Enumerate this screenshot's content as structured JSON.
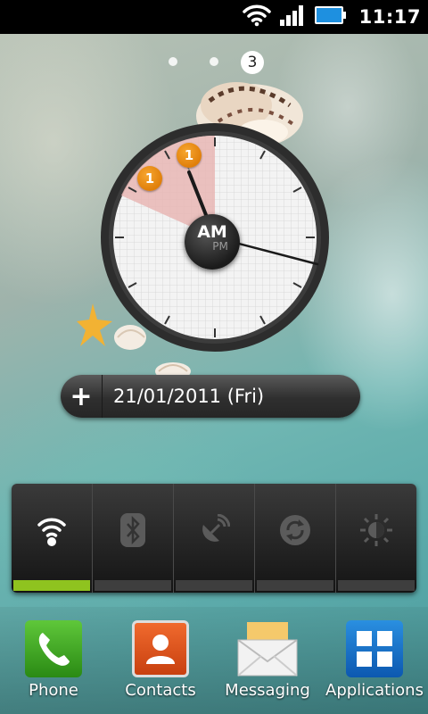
{
  "status_bar": {
    "time": "11:17",
    "icons": [
      "wifi-icon",
      "signal-icon",
      "battery-icon"
    ]
  },
  "home_screen": {
    "current_page": "3",
    "page_count": 3
  },
  "clock_widget": {
    "am_label": "AM",
    "pm_label": "PM",
    "badges": [
      "1",
      "1"
    ]
  },
  "date_widget": {
    "add_label": "+",
    "date": "21/01/2011 (Fri)"
  },
  "power_control": {
    "toggles": [
      {
        "name": "wifi",
        "icon": "wifi-icon",
        "enabled": true
      },
      {
        "name": "bluetooth",
        "icon": "bluetooth-icon",
        "enabled": false
      },
      {
        "name": "gps",
        "icon": "gps-icon",
        "enabled": false
      },
      {
        "name": "sync",
        "icon": "sync-icon",
        "enabled": false
      },
      {
        "name": "brightness",
        "icon": "brightness-icon",
        "enabled": false
      }
    ]
  },
  "dock": {
    "items": [
      {
        "label": "Phone",
        "icon": "phone-icon"
      },
      {
        "label": "Contacts",
        "icon": "contacts-icon"
      },
      {
        "label": "Messaging",
        "icon": "messaging-icon"
      },
      {
        "label": "Applications",
        "icon": "applications-icon"
      }
    ]
  },
  "colors": {
    "accent_green": "#8fc31f",
    "badge_orange": "#f0930f",
    "clock_sector": "#e8b6b4"
  }
}
